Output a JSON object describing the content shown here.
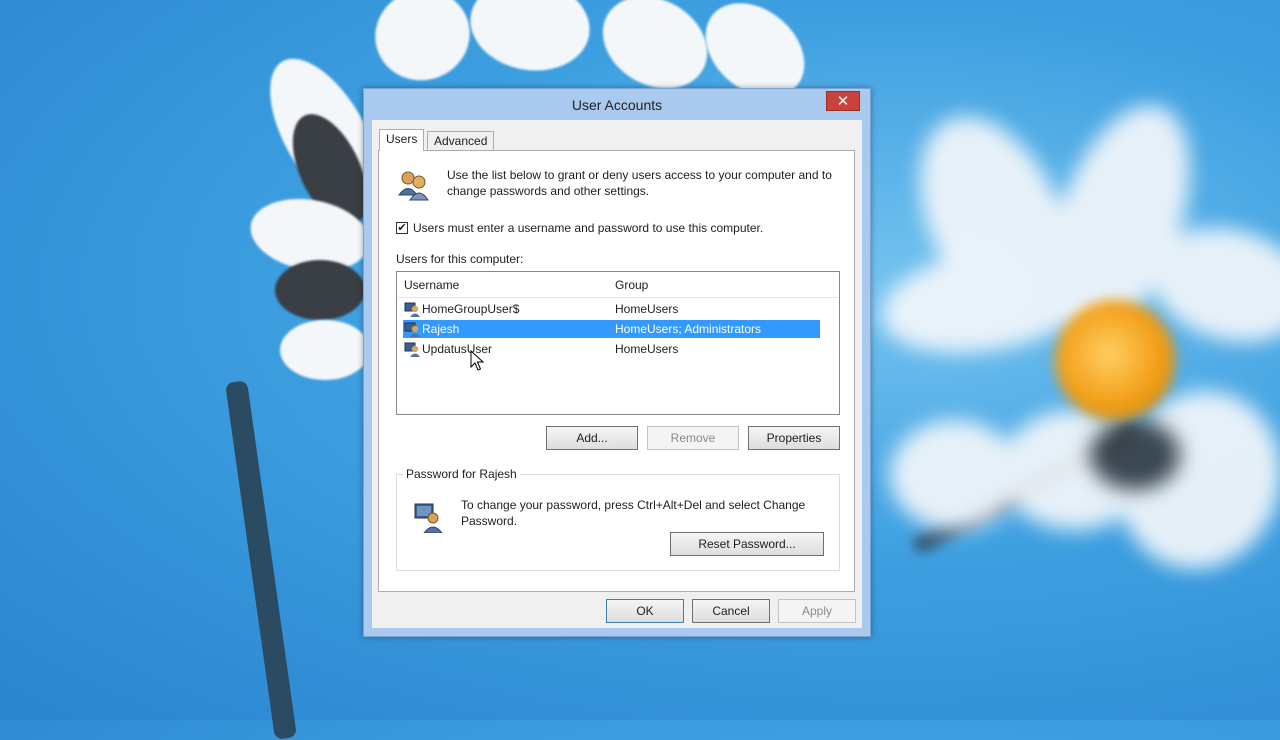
{
  "window": {
    "title": "User Accounts",
    "close_label": "✕"
  },
  "tabs": [
    {
      "label": "Users"
    },
    {
      "label": "Advanced"
    }
  ],
  "intro_text": "Use the list below to grant or deny users access to your computer and to change passwords and other settings.",
  "require_password": {
    "checked": true,
    "check_glyph": "✔",
    "label": "Users must enter a username and password to use this computer."
  },
  "users_list": {
    "label": "Users for this computer:",
    "columns": [
      "Username",
      "Group"
    ],
    "rows": [
      {
        "username": "HomeGroupUser$",
        "group": "HomeUsers",
        "selected": false
      },
      {
        "username": "Rajesh",
        "group": "HomeUsers; Administrators",
        "selected": true
      },
      {
        "username": "UpdatusUser",
        "group": "HomeUsers",
        "selected": false
      }
    ]
  },
  "list_buttons": {
    "add": "Add...",
    "remove": "Remove",
    "properties": "Properties"
  },
  "password_group": {
    "title": "Password for Rajesh",
    "text": "To change your password, press Ctrl+Alt+Del and select Change Password.",
    "reset_button": "Reset Password..."
  },
  "dialog_buttons": {
    "ok": "OK",
    "cancel": "Cancel",
    "apply": "Apply"
  },
  "colors": {
    "selection": "#3399ff",
    "close_button": "#c9433c",
    "window_frame": "#a9c9ee"
  }
}
